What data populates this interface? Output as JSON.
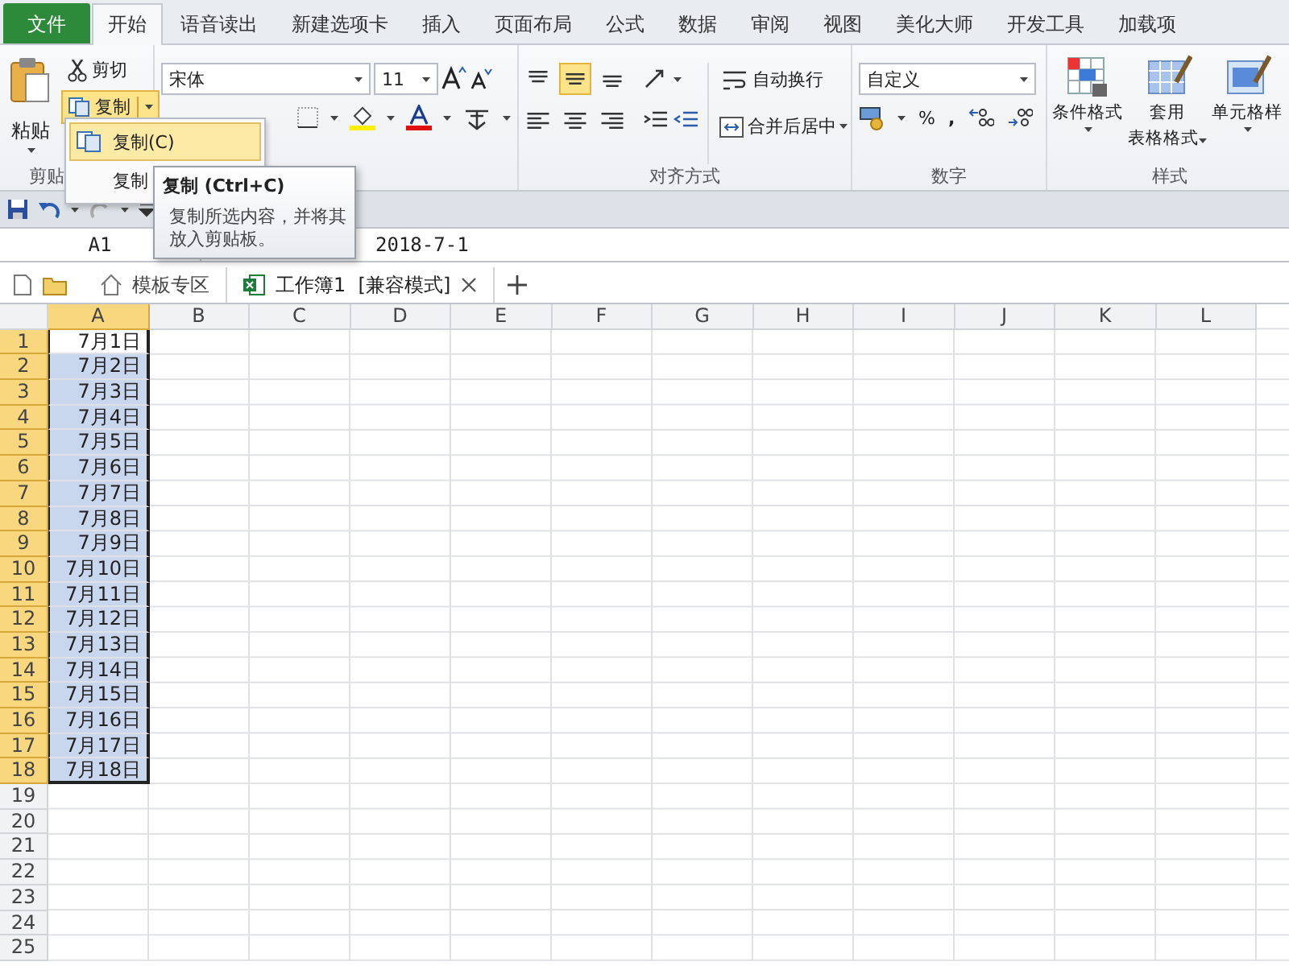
{
  "tabs": [
    {
      "label": "文件",
      "kind": "file",
      "selected": false
    },
    {
      "label": "开始",
      "kind": "tab",
      "selected": true
    },
    {
      "label": "语音读出",
      "kind": "tab",
      "selected": false
    },
    {
      "label": "新建选项卡",
      "kind": "tab",
      "selected": false
    },
    {
      "label": "插入",
      "kind": "tab",
      "selected": false
    },
    {
      "label": "页面布局",
      "kind": "tab",
      "selected": false
    },
    {
      "label": "公式",
      "kind": "tab",
      "selected": false
    },
    {
      "label": "数据",
      "kind": "tab",
      "selected": false
    },
    {
      "label": "审阅",
      "kind": "tab",
      "selected": false
    },
    {
      "label": "视图",
      "kind": "tab",
      "selected": false
    },
    {
      "label": "美化大师",
      "kind": "tab",
      "selected": false
    },
    {
      "label": "开发工具",
      "kind": "tab",
      "selected": false
    },
    {
      "label": "加载项",
      "kind": "tab",
      "selected": false
    }
  ],
  "ribbon": {
    "clipboard": {
      "paste": "粘贴",
      "cut": "剪切",
      "copy": "复制",
      "label": "剪贴",
      "copy_menu": [
        {
          "label": "复制(C)",
          "selected": true
        },
        {
          "label": "复制",
          "selected": false
        }
      ]
    },
    "font": {
      "name": "宋体",
      "size": "11"
    },
    "alignment": {
      "label": "对齐方式",
      "wrap": "自动换行",
      "merge": "合并后居中",
      "vertical": [
        {
          "kind": "top",
          "selected": false
        },
        {
          "kind": "middle",
          "selected": true
        },
        {
          "kind": "bottom",
          "selected": false
        }
      ],
      "horizontal": [
        {
          "kind": "left",
          "selected": false
        },
        {
          "kind": "center",
          "selected": false
        },
        {
          "kind": "right",
          "selected": false
        }
      ]
    },
    "number": {
      "label": "数字",
      "format": "自定义",
      "percent": "%",
      "comma": ","
    },
    "styles": {
      "label": "样式",
      "buttons": [
        {
          "lines": [
            "条件格式"
          ],
          "kind": "conditional"
        },
        {
          "lines": [
            "套用",
            "表格格式"
          ],
          "kind": "table"
        },
        {
          "lines": [
            "单元格样"
          ],
          "kind": "cell"
        }
      ]
    }
  },
  "tooltip": {
    "title": "复制 (Ctrl+C)",
    "text": "复制所选内容，并将其放入剪贴板。"
  },
  "name_box": "A1",
  "formula": "2018-7-1",
  "doc_tabs": [
    {
      "label": "模板专区",
      "kind": "home",
      "selected": false
    },
    {
      "label": "工作簿1  [兼容模式]",
      "kind": "workbook",
      "selected": true
    }
  ],
  "columns": [
    {
      "label": "A",
      "selected": true
    },
    {
      "label": "B",
      "selected": false
    },
    {
      "label": "C",
      "selected": false
    },
    {
      "label": "D",
      "selected": false
    },
    {
      "label": "E",
      "selected": false
    },
    {
      "label": "F",
      "selected": false
    },
    {
      "label": "G",
      "selected": false
    },
    {
      "label": "H",
      "selected": false
    },
    {
      "label": "I",
      "selected": false
    },
    {
      "label": "J",
      "selected": false
    },
    {
      "label": "K",
      "selected": false
    },
    {
      "label": "L",
      "selected": false
    }
  ],
  "rows": [
    {
      "num": "1",
      "value": "7月1日",
      "selected": true,
      "active": true
    },
    {
      "num": "2",
      "value": "7月2日",
      "selected": true,
      "active": false
    },
    {
      "num": "3",
      "value": "7月3日",
      "selected": true,
      "active": false
    },
    {
      "num": "4",
      "value": "7月4日",
      "selected": true,
      "active": false
    },
    {
      "num": "5",
      "value": "7月5日",
      "selected": true,
      "active": false
    },
    {
      "num": "6",
      "value": "7月6日",
      "selected": true,
      "active": false
    },
    {
      "num": "7",
      "value": "7月7日",
      "selected": true,
      "active": false
    },
    {
      "num": "8",
      "value": "7月8日",
      "selected": true,
      "active": false
    },
    {
      "num": "9",
      "value": "7月9日",
      "selected": true,
      "active": false
    },
    {
      "num": "10",
      "value": "7月10日",
      "selected": true,
      "active": false
    },
    {
      "num": "11",
      "value": "7月11日",
      "selected": true,
      "active": false
    },
    {
      "num": "12",
      "value": "7月12日",
      "selected": true,
      "active": false
    },
    {
      "num": "13",
      "value": "7月13日",
      "selected": true,
      "active": false
    },
    {
      "num": "14",
      "value": "7月14日",
      "selected": true,
      "active": false
    },
    {
      "num": "15",
      "value": "7月15日",
      "selected": true,
      "active": false
    },
    {
      "num": "16",
      "value": "7月16日",
      "selected": true,
      "active": false
    },
    {
      "num": "17",
      "value": "7月17日",
      "selected": true,
      "active": false
    },
    {
      "num": "18",
      "value": "7月18日",
      "selected": true,
      "active": false
    },
    {
      "num": "19",
      "selected": false,
      "active": false
    },
    {
      "num": "20",
      "selected": false,
      "active": false
    },
    {
      "num": "21",
      "selected": false,
      "active": false
    },
    {
      "num": "22",
      "selected": false,
      "active": false
    },
    {
      "num": "23",
      "selected": false,
      "active": false
    },
    {
      "num": "24",
      "selected": false,
      "active": false
    },
    {
      "num": "25",
      "selected": false,
      "active": false
    }
  ]
}
